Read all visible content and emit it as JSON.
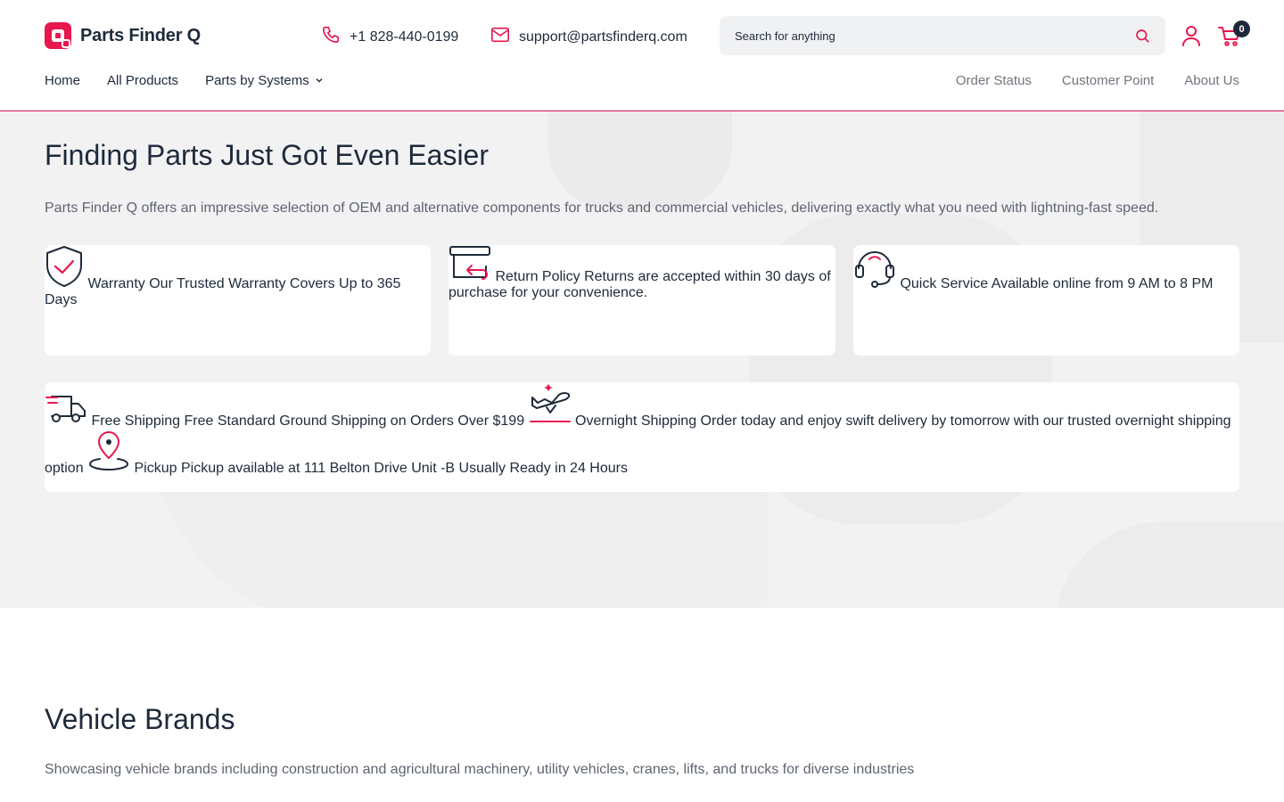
{
  "brand": {
    "name": "Parts Finder Q",
    "accent": "#e8174e",
    "dark": "#1e2a3a"
  },
  "header": {
    "phone": "+1 828-440-0199",
    "email": "support@partsfinderq.com",
    "search_placeholder": "Search for anything",
    "cart_count": "0"
  },
  "nav": {
    "left": [
      "Home",
      "All Products",
      "Parts by Systems"
    ],
    "right": [
      "Order Status",
      "Customer Point",
      "About Us"
    ]
  },
  "hero": {
    "title": "Finding Parts Just Got Even Easier",
    "lead": "Parts Finder Q offers an impressive selection of OEM and alternative components for trucks and commercial vehicles, delivering exactly what you need with lightning-fast speed."
  },
  "features_row1": [
    {
      "icon": "shield-check-icon",
      "title": "Warranty",
      "desc": "Our Trusted Warranty Covers Up to 365 Days"
    },
    {
      "icon": "return-box-icon",
      "title": "Return Policy",
      "desc": "Returns are accepted within 30 days of purchase for your convenience."
    },
    {
      "icon": "headset-icon",
      "title": "Quick Service",
      "desc": "Available online from 9 AM to 8 PM"
    }
  ],
  "features_row2": [
    {
      "icon": "truck-icon",
      "title": "Free Shipping",
      "desc": "Free Standard Ground Shipping on Orders Over $199"
    },
    {
      "icon": "plane-icon",
      "title": "Overnight Shipping",
      "desc": "Order today and enjoy swift delivery by tomorrow with our trusted overnight shipping option"
    },
    {
      "icon": "map-pin-icon",
      "title": "Pickup",
      "desc": "Pickup available at 111 Belton Drive Unit -B Usually Ready in 24 Hours"
    }
  ],
  "brands": {
    "title": "Vehicle Brands",
    "desc": "Showcasing vehicle brands including construction and agricultural machinery, utility vehicles, cranes, lifts, and trucks for diverse industries"
  }
}
